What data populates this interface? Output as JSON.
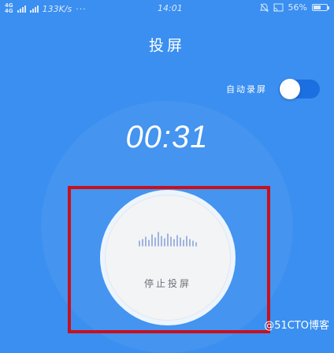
{
  "status_bar": {
    "signal_label": "4G",
    "speed": "133K/s",
    "more": "···",
    "time": "14:01",
    "battery": "56%",
    "battery_level": 0.56,
    "icons": [
      "signal-bars-icon",
      "bell-off-icon",
      "cast-icon",
      "battery-icon"
    ]
  },
  "header": {
    "title": "投屏"
  },
  "auto_record": {
    "label": "自动录屏",
    "enabled": true
  },
  "timer": {
    "elapsed": "00:31"
  },
  "stop_button": {
    "label": "停止投屏",
    "icon": "audio-wave-icon"
  },
  "watermark": {
    "text": "@51CTO博客"
  },
  "colors": {
    "background": "#3a8ff0",
    "highlight": "#c8101c",
    "toggle_on": "#1c6fe0"
  }
}
